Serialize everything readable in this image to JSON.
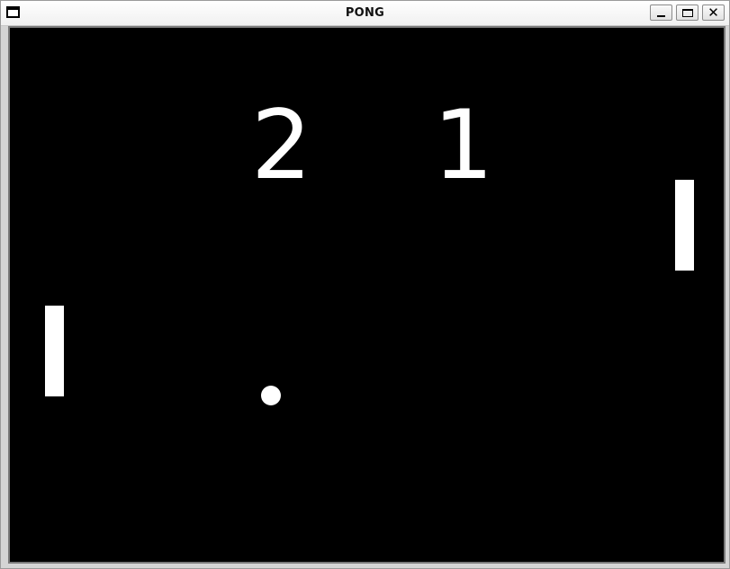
{
  "window": {
    "title": "PONG",
    "controls": {
      "minimize": "minimize",
      "maximize": "maximize",
      "close": "close"
    }
  },
  "game": {
    "score_left": "2",
    "score_right": "1",
    "colors": {
      "background": "#000000",
      "foreground": "#ffffff"
    }
  }
}
